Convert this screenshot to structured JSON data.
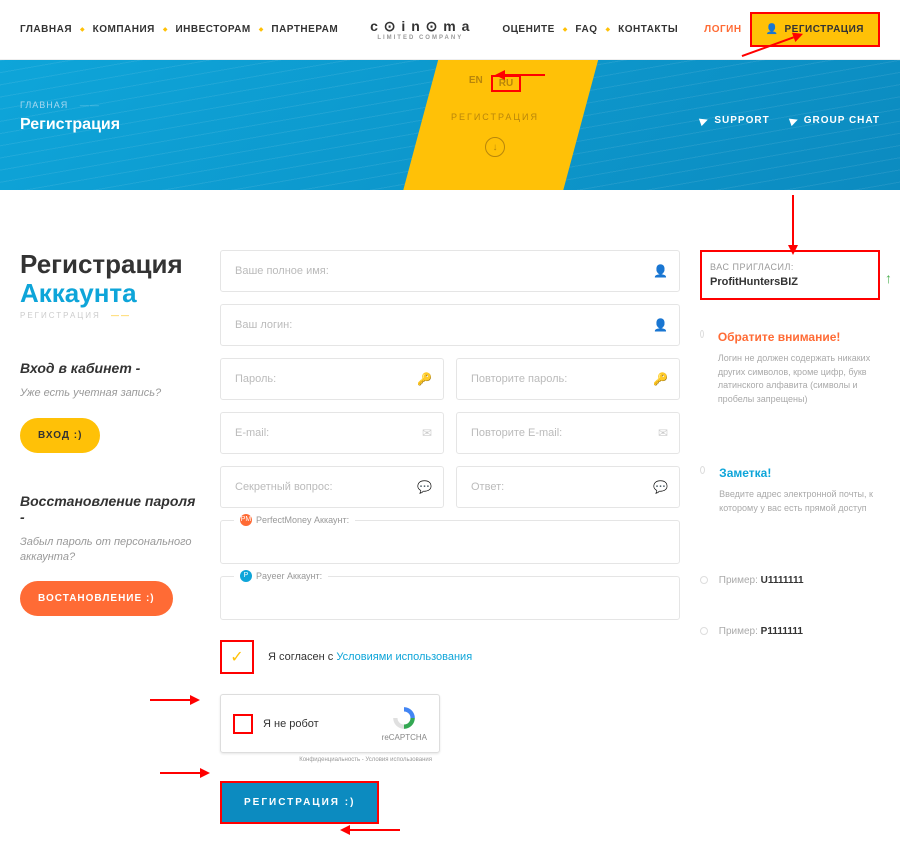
{
  "header": {
    "nav_left": [
      "ГЛАВНАЯ",
      "КОМПАНИЯ",
      "ИНВЕСТОРАМ",
      "ПАРТНЕРАМ"
    ],
    "logo": "c ⊙ i n ⊙ m a",
    "logo_sub": "LIMITED COMPANY",
    "nav_right": [
      "ОЦЕНИТЕ",
      "FAQ",
      "КОНТАКТЫ"
    ],
    "login": "ЛОГИН",
    "register": "РЕГИСТРАЦИЯ"
  },
  "hero": {
    "lang_en": "EN",
    "lang_ru": "RU",
    "crumb_home": "ГЛАВНАЯ",
    "title": "Регистрация",
    "reg_label": "РЕГИСТРАЦИЯ",
    "support": "SUPPORT",
    "chat": "GROUP CHAT"
  },
  "left": {
    "head1": "Регистрация",
    "head2": "Аккаунта",
    "sub": "РЕГИСТРАЦИЯ",
    "login_title": "Вход в кабинет -",
    "login_text": "Уже есть учетная запись?",
    "login_btn": "ВХОД  :)",
    "recover_title": "Восстановление пароля -",
    "recover_text": "Забыл пароль от персонального аккаунта?",
    "recover_btn": "ВОСТАНОВЛЕНИЕ  :)"
  },
  "form": {
    "fullname": "Ваше полное имя:",
    "login": "Ваш логин:",
    "password": "Пароль:",
    "password2": "Повторите пароль:",
    "email": "E-mail:",
    "email2": "Повторите E-mail:",
    "secret_q": "Секретный вопрос:",
    "secret_a": "Ответ:",
    "pm_label": "PerfectMoney Аккаунт:",
    "payeer_label": "Payeer Аккаунт:",
    "agree_pre": "Я согласен с ",
    "agree_link": "Условиями использования",
    "captcha": "Я не робот",
    "captcha_brand": "reCAPTCHA",
    "captcha_terms": "Конфиденциальность - Условия использования",
    "submit": "РЕГИСТРАЦИЯ  :)"
  },
  "right": {
    "invite_label": "ВАС ПРИГЛАСИЛ:",
    "invite_name": "ProfitHuntersBIZ",
    "note1_title": "Обратите внимание!",
    "note1_text": "Логин не должен содержать никаких других символов, кроме цифр, букв латинского алфавита (символы и пробелы запрещены)",
    "note2_title": "Заметка!",
    "note2_text": "Введите адрес электронной почты, к которому у вас есть прямой доступ",
    "ex1_label": "Пример: ",
    "ex1_val": "U1111111",
    "ex2_label": "Пример: ",
    "ex2_val": "P1111111"
  }
}
